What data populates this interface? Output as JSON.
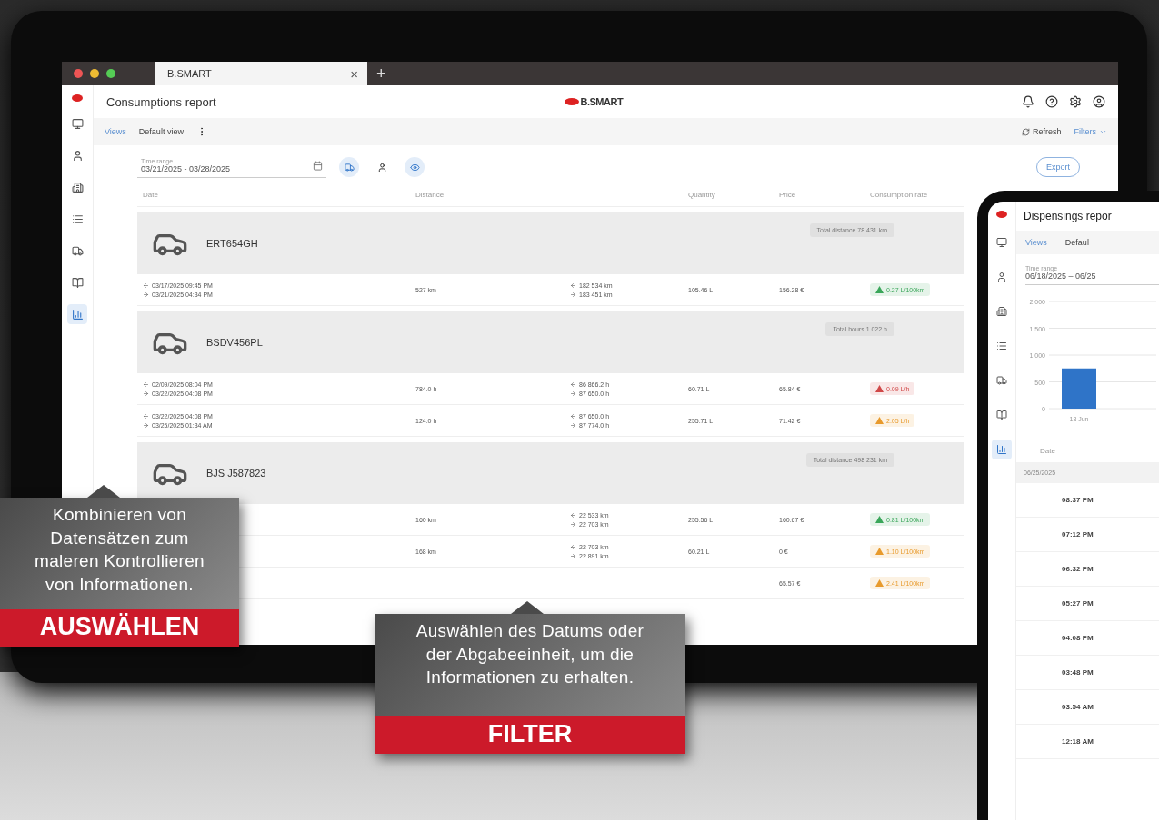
{
  "browser": {
    "tab": "B.SMART",
    "close": "×",
    "new_tab": "+"
  },
  "app": {
    "title": "Consumptions report",
    "logo": "B.SMART",
    "sidebar": [
      {
        "kind": "monitor",
        "selected": false
      },
      {
        "kind": "person",
        "selected": false
      },
      {
        "kind": "building",
        "selected": false
      },
      {
        "kind": "list",
        "selected": false
      },
      {
        "kind": "truck",
        "selected": false
      },
      {
        "kind": "book",
        "selected": false
      },
      {
        "kind": "chart",
        "selected": true
      }
    ],
    "toolbar": {
      "views": "Views",
      "default_view": "Default view",
      "refresh": "Refresh",
      "filters": "Filters"
    },
    "time_range": {
      "label": "Time range",
      "value": "03/21/2025 - 03/28/2025"
    },
    "export": "Export",
    "columns": [
      "Date",
      "Distance",
      "Quantity",
      "Price",
      "Consumption rate"
    ],
    "groups": [
      {
        "plate": "ERT654GH",
        "chip": "Total distance 78 431 km",
        "rows": [
          {
            "start": "03/17/2025 09:45 PM",
            "end": "03/21/2025 04:34 PM",
            "distance": "527 km",
            "odo_start": "182 534 km",
            "odo_end": "183 451 km",
            "quantity": "105.46 L",
            "price": "156.28 €",
            "rate": "0.27 L/100km",
            "color": "#3aa65a"
          }
        ]
      },
      {
        "plate": "BSDV456PL",
        "chip": "Total hours 1 022 h",
        "rows": [
          {
            "start": "02/09/2025 08:04 PM",
            "end": "03/22/2025 04:08 PM",
            "distance": "784.0 h",
            "odo_start": "86 866.2 h",
            "odo_end": "87 650.0 h",
            "quantity": "60.71 L",
            "price": "65.84 €",
            "rate": "0.09 L/h",
            "color": "#d04848"
          },
          {
            "start": "03/22/2025 04:08 PM",
            "end": "03/25/2025 01:34 AM",
            "distance": "124.0 h",
            "odo_start": "87 650.0 h",
            "odo_end": "87 774.0 h",
            "quantity": "255.71 L",
            "price": "71.42 €",
            "rate": "2.05 L/h",
            "color": "#e89a2c"
          }
        ]
      },
      {
        "plate": "BJS J587823",
        "chip": "Total distance 498 231 km",
        "rows": [
          {
            "distance": "160 km",
            "odo_start": "22 533 km",
            "odo_end": "22 703 km",
            "quantity": "255.56 L",
            "price": "160.67 €",
            "rate": "0.81 L/100km",
            "color": "#3aa65a"
          },
          {
            "distance": "168 km",
            "odo_start": "22 703 km",
            "odo_end": "22 891 km",
            "quantity": "60.21 L",
            "price": "0 €",
            "rate": "1.10 L/100km",
            "color": "#e89a2c"
          },
          {
            "price": "65.57 €",
            "rate": "2.41 L/100km",
            "color": "#e89a2c"
          }
        ]
      }
    ]
  },
  "tablet": {
    "title": "Dispensings repor",
    "views": "Views",
    "default_view": "Defaul",
    "time_range": {
      "label": "Time range",
      "value": "06/18/2025 – 06/25"
    },
    "chart_data": {
      "type": "bar",
      "categories": [
        "18 Jun"
      ],
      "values": [
        750
      ],
      "ylim": [
        0,
        2000
      ],
      "grid": true,
      "yticks": [
        {
          "value": 0,
          "label": "0"
        },
        {
          "value": 500,
          "label": "500"
        },
        {
          "value": 1000,
          "label": "1 000"
        },
        {
          "value": 1500,
          "label": "1 500"
        },
        {
          "value": 2000,
          "label": "2 000"
        }
      ]
    },
    "date_column": "Date",
    "group": "06/25/2025",
    "times": [
      "08:37 PM",
      "07:12 PM",
      "06:32 PM",
      "05:27 PM",
      "04:08 PM",
      "03:48 PM",
      "03:54 AM",
      "12:18 AM"
    ]
  },
  "callouts": [
    {
      "text": "Kombinieren von\nDatensätzen zum\nmaleren Kontrollieren\nvon Informationen.",
      "title": "AUSWÄHLEN"
    },
    {
      "text": "Auswählen des Datums oder\nder Abgabeeinheit, um die\nInformationen zu erhalten.",
      "title": "FILTER"
    }
  ]
}
